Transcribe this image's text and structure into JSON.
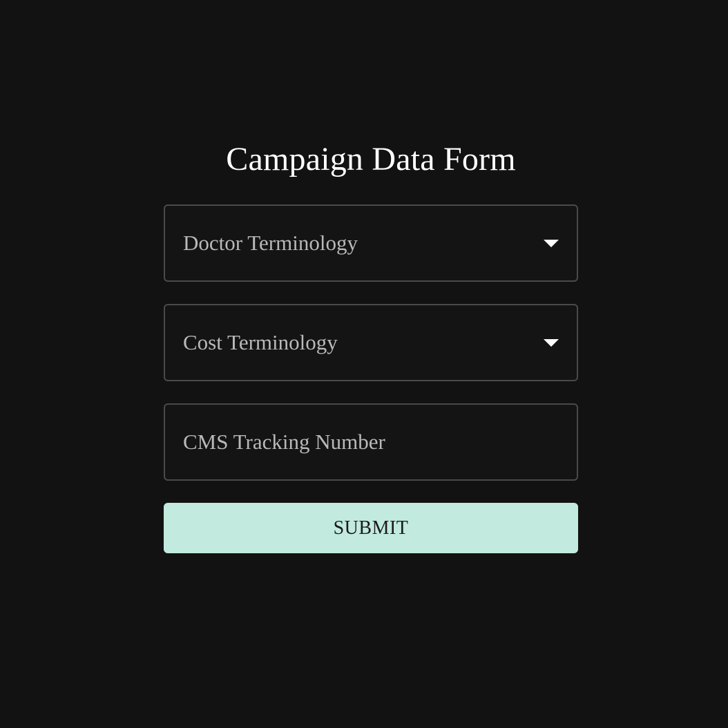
{
  "form": {
    "title": "Campaign Data Form",
    "fields": [
      {
        "type": "select",
        "placeholder": "Doctor Terminology",
        "icon": "caret-down-icon"
      },
      {
        "type": "select",
        "placeholder": "Cost Terminology",
        "icon": "caret-down-icon"
      },
      {
        "type": "text",
        "placeholder": "CMS Tracking Number"
      }
    ],
    "submit_label": "SUBMIT"
  },
  "colors": {
    "background": "#121212",
    "field_border": "#4a4a4a",
    "placeholder_text": "#b9b9b9",
    "title_text": "#ffffff",
    "submit_background": "#c2eadf",
    "submit_text": "#1a1a1a"
  }
}
